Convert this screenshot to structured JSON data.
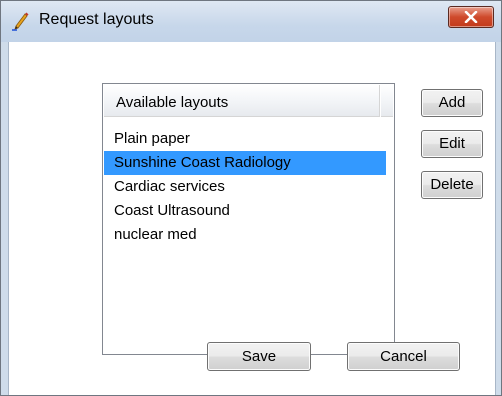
{
  "window": {
    "title": "Request layouts",
    "close_symbol": "✕"
  },
  "icons": {
    "app": "pen-icon",
    "close": "close-icon"
  },
  "colors": {
    "selection": "#3399ff",
    "close_button": "#c7452a"
  },
  "list": {
    "header": "Available layouts",
    "items": [
      "Plain paper",
      "Sunshine Coast Radiology",
      "Cardiac services",
      "Coast Ultrasound",
      "nuclear med"
    ],
    "selected_item": "Sunshine Coast Radiology"
  },
  "buttons": {
    "add": "Add",
    "edit": "Edit",
    "delete": "Delete",
    "save": "Save",
    "cancel": "Cancel"
  }
}
